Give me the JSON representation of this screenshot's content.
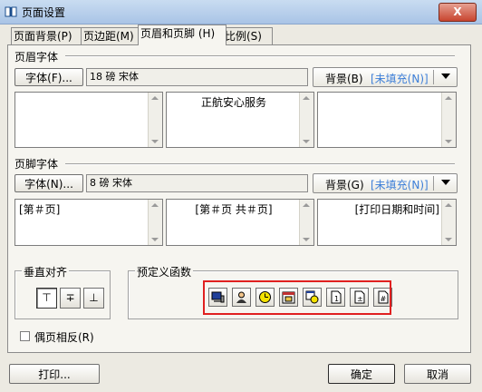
{
  "window": {
    "title": "页面设置",
    "close_label": "X"
  },
  "tabs": [
    {
      "label": "页面背景(P)",
      "active": false
    },
    {
      "label": "页边距(M)",
      "active": false
    },
    {
      "label": "页眉和页脚 (H)",
      "active": true
    },
    {
      "label": "比例(S)",
      "active": false
    }
  ],
  "header": {
    "group_label": "页眉字体",
    "font_button": "字体(F)...",
    "font_value": "18 磅 宋体",
    "background_label": "背景(B)",
    "background_value": "[未填充(N)]",
    "left_text": "",
    "center_text": "正航安心服务",
    "right_text": ""
  },
  "footer": {
    "group_label": "页脚字体",
    "font_button": "字体(N)...",
    "font_value": "8 磅 宋体",
    "background_label": "背景(G)",
    "background_value": "[未填充(N)]",
    "left_text": "[第＃页]",
    "center_text": "[第＃页 共＃页]",
    "right_text": "[打印日期和时间]"
  },
  "vertical_align": {
    "label": "垂直对齐",
    "buttons": [
      {
        "glyph": "⊤",
        "pressed": true
      },
      {
        "glyph": "∓",
        "pressed": false
      },
      {
        "glyph": "⊥",
        "pressed": false
      }
    ]
  },
  "predefined": {
    "label": "预定义函数",
    "icons": [
      "computer-icon",
      "user-icon",
      "clock-icon",
      "calendar-icon",
      "date-time-icon",
      "page-number-icon",
      "total-pages-icon",
      "page-of-total-icon"
    ]
  },
  "mirror_checkbox": {
    "label": "偶页相反(R)",
    "checked": false
  },
  "buttons": {
    "print": "打印...",
    "ok": "确定",
    "cancel": "取消"
  },
  "colors": {
    "accent": "#3d7fd8",
    "highlight": "#e02020"
  }
}
